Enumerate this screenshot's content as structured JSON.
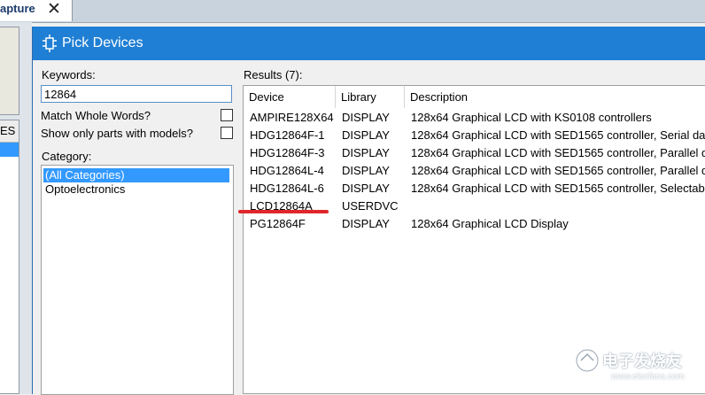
{
  "background": {
    "tab_label": "apture",
    "tab_close": "✕",
    "list_header": "ES"
  },
  "dialog": {
    "title": "Pick Devices",
    "keywords_label": "Keywords:",
    "keywords_value": "12864",
    "match_whole_words_label": "Match Whole Words?",
    "match_whole_words_checked": false,
    "show_only_models_label": "Show only parts with models?",
    "show_only_models_checked": false,
    "category_label": "Category:",
    "categories": [
      "(All Categories)",
      "Optoelectronics"
    ],
    "selected_category": "(All Categories)",
    "results_label": "Results (7):",
    "columns": [
      "Device",
      "Library",
      "Description"
    ],
    "rows": [
      {
        "device": "AMPIRE128X64",
        "library": "DISPLAY",
        "description": "128x64 Graphical LCD with KS0108 controllers"
      },
      {
        "device": "HDG12864F-1",
        "library": "DISPLAY",
        "description": "128x64 Graphical LCD with SED1565 controller, Serial dat"
      },
      {
        "device": "HDG12864F-3",
        "library": "DISPLAY",
        "description": "128x64 Graphical LCD with SED1565 controller, Parallel d"
      },
      {
        "device": "HDG12864L-4",
        "library": "DISPLAY",
        "description": "128x64 Graphical LCD with SED1565 controller, Parallel d"
      },
      {
        "device": "HDG12864L-6",
        "library": "DISPLAY",
        "description": "128x64 Graphical LCD with SED1565 controller, Selectabl"
      },
      {
        "device": "LCD12864A",
        "library": "USERDVC",
        "description": ""
      },
      {
        "device": "PG12864F",
        "library": "DISPLAY",
        "description": "128x64 Graphical LCD Display"
      }
    ],
    "annotation_color": "#e0262b"
  },
  "watermark": {
    "text": "电子发烧友",
    "sub": "www.elecfans.com"
  },
  "colors": {
    "titlebar": "#1f7fd4",
    "selection": "#3399ff"
  }
}
